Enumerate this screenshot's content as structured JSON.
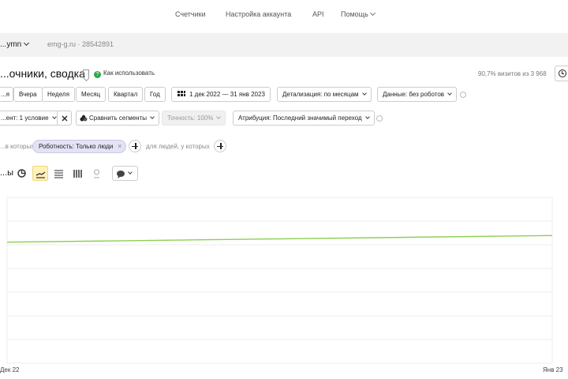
{
  "topnav": {
    "items": [
      "Счетчики",
      "Настройка аккаунта",
      "API",
      "Помощь"
    ]
  },
  "counter": {
    "name": "...ymn",
    "site": "emg-g.ru · 28542891"
  },
  "report": {
    "title": "...очники, сводка",
    "howto": "Как использовать",
    "visits_info": "90,7% визитов из 3 968"
  },
  "toolbar": {
    "periods": [
      "...я",
      "Вчера",
      "Неделя",
      "Месяц",
      "Квартал",
      "Год"
    ],
    "date_range": "1 дек 2022 — 31 янв 2023",
    "detail": "Детализация: по месяцам",
    "data": "Данные: без роботов"
  },
  "segments": {
    "segment": "...ент: 1 условие",
    "compare": "Сравнить сегменты",
    "accuracy": "Точность: 100%",
    "attribution": "Атрибуция: Последний значимый переход"
  },
  "filters": {
    "left_label": "...в которых",
    "chip": "Роботность: Только люди",
    "right_label": "для людей, у которых"
  },
  "graph": {
    "label": "...ы"
  },
  "colors": {
    "line": "#8bd04f",
    "accent_green": "#2ba84a",
    "grid": "#ececec"
  },
  "chart_data": {
    "type": "line",
    "x": [
      "Дек 22",
      "Янв 23"
    ],
    "series": [
      {
        "values": [
          0.73,
          0.77
        ]
      }
    ],
    "grid": true,
    "ylim": [
      0,
      1
    ]
  }
}
